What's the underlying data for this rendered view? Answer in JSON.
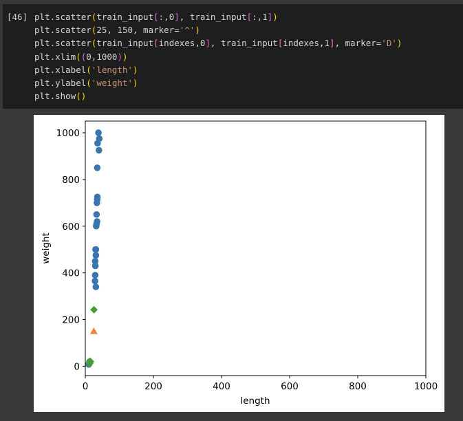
{
  "cell": {
    "prompt": "[46]",
    "code_lines": [
      [
        {
          "t": "plt",
          "c": "#d4d4d4"
        },
        {
          "t": ".scatter",
          "c": "#d4d4d4"
        },
        {
          "t": "(",
          "c": "#ffd700"
        },
        {
          "t": "train_input",
          "c": "#d4d4d4"
        },
        {
          "t": "[",
          "c": "#da70d6"
        },
        {
          "t": ":,0",
          "c": "#d4d4d4"
        },
        {
          "t": "]",
          "c": "#da70d6"
        },
        {
          "t": ", train_input",
          "c": "#d4d4d4"
        },
        {
          "t": "[",
          "c": "#da70d6"
        },
        {
          "t": ":,1",
          "c": "#d4d4d4"
        },
        {
          "t": "]",
          "c": "#da70d6"
        },
        {
          "t": ")",
          "c": "#ffd700"
        }
      ],
      [
        {
          "t": "plt.scatter",
          "c": "#d4d4d4"
        },
        {
          "t": "(",
          "c": "#ffd700"
        },
        {
          "t": "25, 150, marker=",
          "c": "#d4d4d4"
        },
        {
          "t": "'^'",
          "c": "#ce9178"
        },
        {
          "t": ")",
          "c": "#ffd700"
        }
      ],
      [
        {
          "t": "plt.scatter",
          "c": "#d4d4d4"
        },
        {
          "t": "(",
          "c": "#ffd700"
        },
        {
          "t": "train_input",
          "c": "#d4d4d4"
        },
        {
          "t": "[",
          "c": "#da70d6"
        },
        {
          "t": "indexes,0",
          "c": "#d4d4d4"
        },
        {
          "t": "]",
          "c": "#da70d6"
        },
        {
          "t": ", train_input",
          "c": "#d4d4d4"
        },
        {
          "t": "[",
          "c": "#da70d6"
        },
        {
          "t": "indexes,1",
          "c": "#d4d4d4"
        },
        {
          "t": "]",
          "c": "#da70d6"
        },
        {
          "t": ", marker=",
          "c": "#d4d4d4"
        },
        {
          "t": "'D'",
          "c": "#ce9178"
        },
        {
          "t": ")",
          "c": "#ffd700"
        }
      ],
      [
        {
          "t": "plt.xlim",
          "c": "#d4d4d4"
        },
        {
          "t": "(",
          "c": "#ffd700"
        },
        {
          "t": "(",
          "c": "#da70d6"
        },
        {
          "t": "0,1000",
          "c": "#d4d4d4"
        },
        {
          "t": ")",
          "c": "#da70d6"
        },
        {
          "t": ")",
          "c": "#ffd700"
        }
      ],
      [
        {
          "t": "plt.xlabel",
          "c": "#d4d4d4"
        },
        {
          "t": "(",
          "c": "#ffd700"
        },
        {
          "t": "'length'",
          "c": "#ce9178"
        },
        {
          "t": ")",
          "c": "#ffd700"
        }
      ],
      [
        {
          "t": "plt.ylabel",
          "c": "#d4d4d4"
        },
        {
          "t": "(",
          "c": "#ffd700"
        },
        {
          "t": "'weight'",
          "c": "#ce9178"
        },
        {
          "t": ")",
          "c": "#ffd700"
        }
      ],
      [
        {
          "t": "plt.show",
          "c": "#d4d4d4"
        },
        {
          "t": "()",
          "c": "#ffd700"
        }
      ]
    ]
  },
  "chart_data": {
    "type": "scatter",
    "xlabel": "length",
    "ylabel": "weight",
    "xlim": [
      0,
      1000
    ],
    "ylim": [
      -40,
      1050
    ],
    "xticks": [
      0,
      200,
      400,
      600,
      800,
      1000
    ],
    "yticks": [
      0,
      200,
      400,
      600,
      800,
      1000
    ],
    "series": [
      {
        "marker": "circle",
        "color": "#3a75b0",
        "points": [
          [
            38.5,
            1000
          ],
          [
            41,
            975
          ],
          [
            36,
            955
          ],
          [
            40,
            925
          ],
          [
            35,
            850
          ],
          [
            35.5,
            725
          ],
          [
            35,
            715
          ],
          [
            34,
            700
          ],
          [
            33,
            650
          ],
          [
            34.5,
            620
          ],
          [
            33,
            610
          ],
          [
            32,
            600
          ],
          [
            31,
            500
          ],
          [
            30,
            500
          ],
          [
            31,
            475
          ],
          [
            29,
            450
          ],
          [
            29.5,
            430
          ],
          [
            29,
            390
          ],
          [
            28.5,
            365
          ],
          [
            31,
            340
          ],
          [
            12,
            17
          ],
          [
            10.5,
            8.5
          ],
          [
            11,
            11
          ],
          [
            10,
            8
          ],
          [
            12.5,
            19
          ]
        ]
      },
      {
        "marker": "triangle",
        "color": "#ef8535",
        "points": [
          [
            25,
            150
          ]
        ]
      },
      {
        "marker": "diamond",
        "color": "#4b9a38",
        "points": [
          [
            25.5,
            242
          ],
          [
            15,
            19.5
          ],
          [
            14,
            22
          ],
          [
            13,
            12
          ],
          [
            12,
            14
          ]
        ]
      }
    ]
  }
}
